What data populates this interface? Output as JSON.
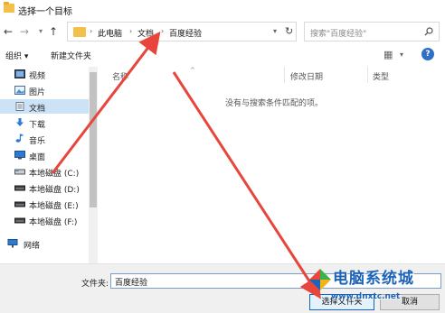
{
  "window": {
    "title": "选择一个目标"
  },
  "nav": {
    "back": "←",
    "forward": "→",
    "recent": "▾",
    "up": "↑"
  },
  "address": {
    "segments": [
      "此电脑",
      "文档",
      "百度经验"
    ],
    "separator": "›"
  },
  "search": {
    "placeholder": "搜索\"百度经验\""
  },
  "toolbar": {
    "organize": "组织 ▾",
    "new_folder": "新建文件夹"
  },
  "sidebar": {
    "items": [
      {
        "label": "视频",
        "icon": "video-icon"
      },
      {
        "label": "图片",
        "icon": "pictures-icon"
      },
      {
        "label": "文档",
        "icon": "documents-icon",
        "selected": true
      },
      {
        "label": "下载",
        "icon": "download-icon"
      },
      {
        "label": "音乐",
        "icon": "music-icon"
      },
      {
        "label": "桌面",
        "icon": "desktop-icon"
      },
      {
        "label": "本地磁盘 (C:)",
        "icon": "drive-icon"
      },
      {
        "label": "本地磁盘 (D:)",
        "icon": "drive-icon"
      },
      {
        "label": "本地磁盘 (E:)",
        "icon": "drive-icon"
      },
      {
        "label": "本地磁盘 (F:)",
        "icon": "drive-icon"
      },
      {
        "label": "网络",
        "icon": "network-icon"
      }
    ]
  },
  "columns": {
    "name": "名称",
    "date": "修改日期",
    "type": "类型"
  },
  "content": {
    "empty_message": "没有与搜索条件匹配的项。"
  },
  "footer": {
    "folder_label": "文件夹:",
    "folder_value": "百度经验",
    "select_button": "选择文件夹",
    "cancel_button": "取消"
  },
  "watermark": {
    "title": "电脑系统城",
    "url": "www.dnxtc.net"
  },
  "colors": {
    "accent": "#0a6acb",
    "selection": "#cce3f7",
    "arrow": "#e8453c",
    "folder": "#f3c14b"
  }
}
